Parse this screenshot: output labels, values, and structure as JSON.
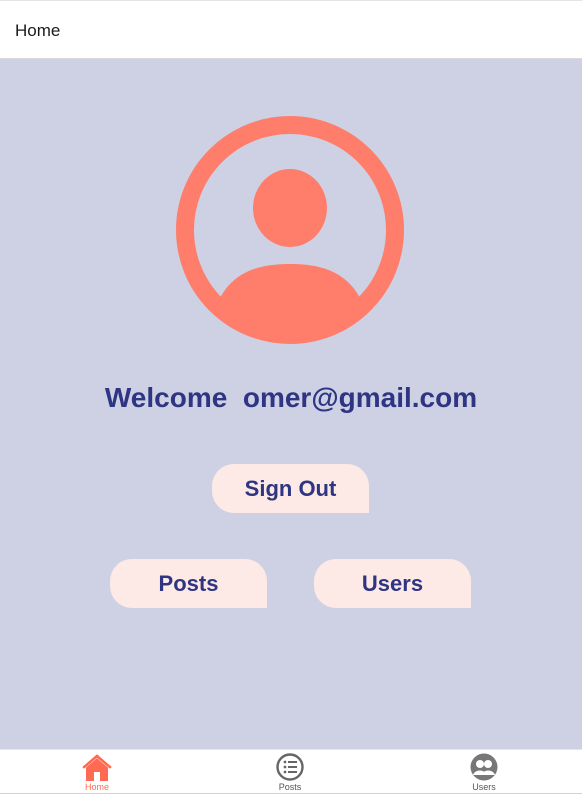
{
  "header": {
    "title": "Home"
  },
  "main": {
    "welcome_prefix": "Welcome",
    "email": "omer@gmail.com",
    "signout_label": "Sign Out",
    "posts_label": "Posts",
    "users_label": "Users"
  },
  "tabbar": {
    "items": [
      {
        "label": "Home",
        "icon": "home-icon",
        "active": true
      },
      {
        "label": "Posts",
        "icon": "list-icon",
        "active": false
      },
      {
        "label": "Users",
        "icon": "users-icon",
        "active": false
      }
    ]
  },
  "colors": {
    "background": "#ced1e4",
    "accent": "#ff7e6b",
    "text_primary": "#2e3582",
    "button_bg": "#fde9e6"
  }
}
